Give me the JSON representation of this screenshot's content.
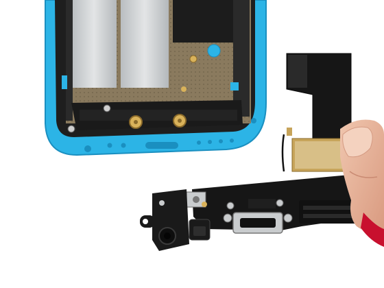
{
  "scene": {
    "subject": "phone-housing-and-charging-port-flex-cable",
    "colors": {
      "background": "#ffffff",
      "case_blue": "#2cb4e6",
      "case_blue_dark": "#1a8fc0",
      "case_inner_black": "#1e1e1e",
      "shield_silver": "#c9ccce",
      "logic_board": "#8a7a5e",
      "flex_black": "#161616",
      "flex_gold": "#c7a45a",
      "finger_skin": "#e8b59a",
      "glove_red": "#c8102e",
      "screw_gold": "#d9b25a"
    },
    "icons": [
      "phone-case",
      "flex-cable",
      "lightning-connector",
      "headphone-jack",
      "finger"
    ]
  }
}
